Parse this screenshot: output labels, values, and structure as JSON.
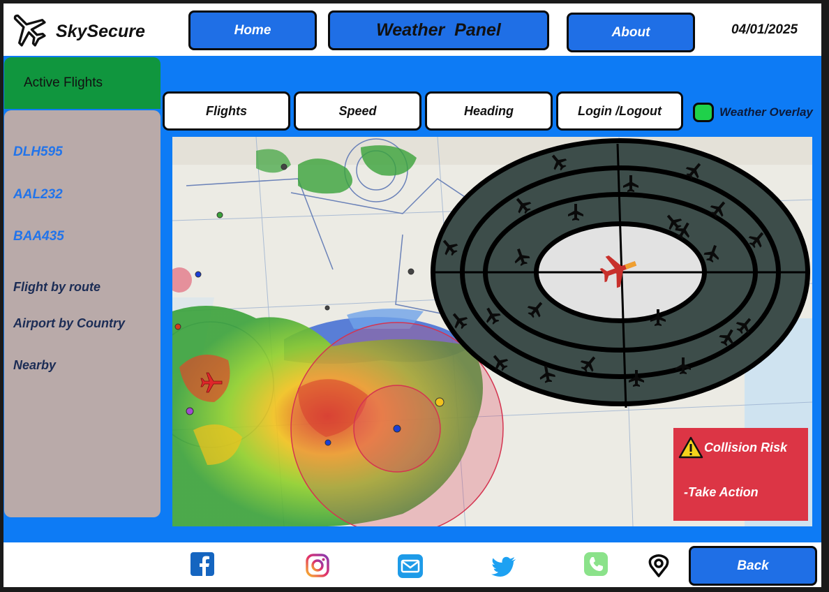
{
  "app": {
    "name": "SkySecure",
    "date": "04/01/2025"
  },
  "header": {
    "home_label": "Home",
    "weather_label": "Weather  Panel",
    "about_label": "About"
  },
  "sidebar": {
    "active_label": "Active Flights",
    "flights": [
      "DLH595",
      "AAL232",
      "BAA435"
    ],
    "nav": [
      "Flight by route",
      "Airport by Country",
      "Nearby"
    ]
  },
  "tabs": [
    "Flights",
    "Speed",
    "Heading",
    "Login /Logout"
  ],
  "overlay": {
    "label": "Weather Overlay",
    "enabled": true,
    "color": "#1fd14a"
  },
  "alert": {
    "title": "Collision Risk",
    "action": "-Take Action",
    "color": "#dc3545"
  },
  "footer": {
    "icons": [
      "facebook-icon",
      "instagram-icon",
      "mail-icon",
      "twitter-icon",
      "phone-icon",
      "location-pin-icon"
    ],
    "back_label": "Back"
  },
  "colors": {
    "accent": "#1f6fe6",
    "background": "#0d7bf5",
    "sidebar": "#b9aaa9",
    "active": "#10963e"
  }
}
